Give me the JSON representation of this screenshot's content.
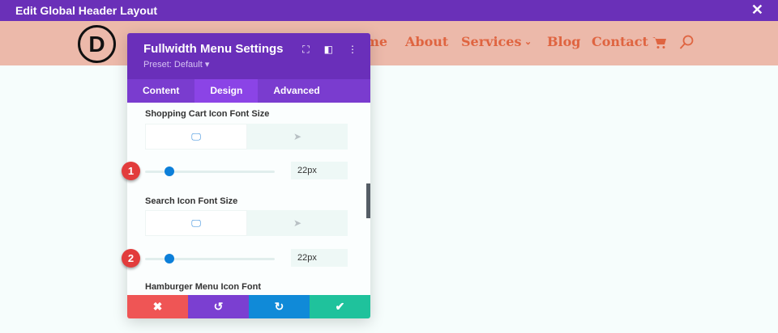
{
  "topbar": {
    "title": "Edit Global Header Layout",
    "close": "✕"
  },
  "header": {
    "logo": "D",
    "nav": [
      "me",
      "About",
      "Services",
      "Blog",
      "Contact"
    ],
    "services_chevron": "⌄"
  },
  "modal": {
    "title": "Fullwidth Menu Settings",
    "preset": "Preset: Default ▾",
    "tabs": [
      "Content",
      "Design",
      "Advanced"
    ],
    "settings": [
      {
        "label": "Shopping Cart Icon Font Size",
        "value": "22px",
        "slider_percent": 19,
        "badge": "1"
      },
      {
        "label": "Search Icon Font Size",
        "value": "22px",
        "slider_percent": 19,
        "badge": "2"
      },
      {
        "label": "Hamburger Menu Icon Font"
      }
    ]
  },
  "colors": {
    "accent": "#6a30b8",
    "nav": "#df6440"
  }
}
